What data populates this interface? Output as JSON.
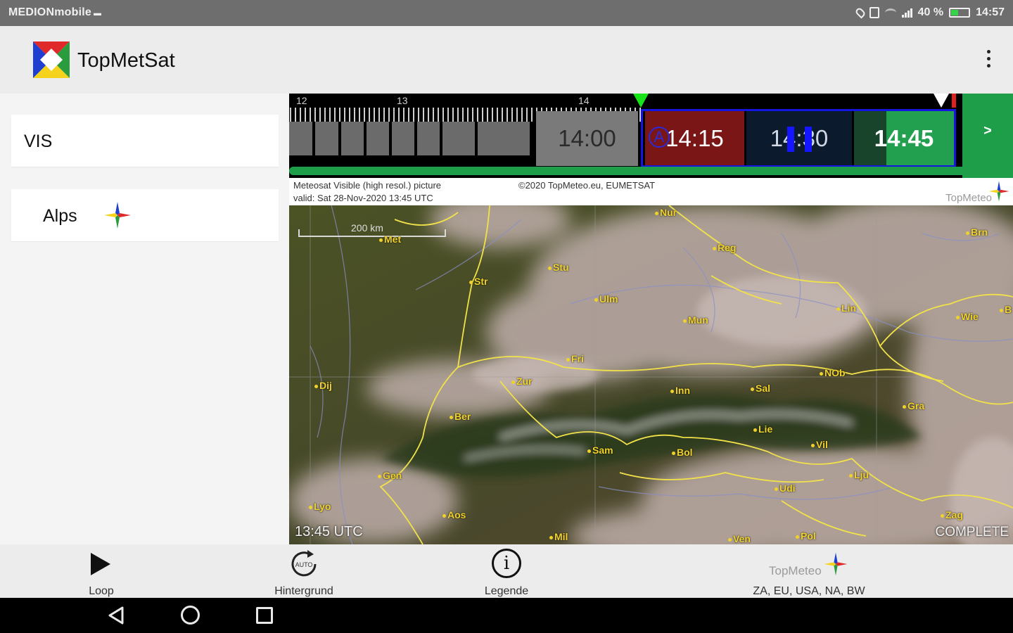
{
  "status_bar": {
    "carrier": "MEDIONmobile",
    "battery": "40 %",
    "battery_level": 0.4,
    "time": "14:57"
  },
  "app_bar": {
    "title": "TopMetSat"
  },
  "sidebar": {
    "product": "VIS",
    "region": "Alps"
  },
  "timeline": {
    "hour_labels": [
      "12",
      "13",
      "14"
    ],
    "slots": {
      "t1400": "14:00",
      "t1415": "14:15",
      "t1430": "14:30",
      "t1445": "14:45"
    },
    "auto_marker": "A",
    "next_label": ">"
  },
  "image_header": {
    "line1": "Meteosat Visible (high resol.) picture",
    "line2": "valid:  Sat  28-Nov-2020  13:45 UTC",
    "copyright": "©2020 TopMeteo.eu, EUMETSAT",
    "brand": "TopMeteo"
  },
  "map": {
    "scale_label": "200 km",
    "utc_label": "13:45 UTC",
    "status_label": "COMPLETE",
    "cities": [
      "Nur",
      "Brn",
      "Met",
      "Reg",
      "Stu",
      "Str",
      "Ulm",
      "Lin",
      "Mun",
      "Wie",
      "B",
      "Fri",
      "Dij",
      "Zur",
      "Inn",
      "Sal",
      "NOb",
      "Gra",
      "Ber",
      "Lie",
      "Vil",
      "Bol",
      "Sam",
      "Lju",
      "Gen",
      "Lyo",
      "Aos",
      "Udi",
      "Zag",
      "Mil",
      "Ven",
      "Pol"
    ]
  },
  "bottom_bar": {
    "loop": "Loop",
    "background": "Hintergrund",
    "auto_icon_text": "AUTO",
    "legend": "Legende",
    "brand": "TopMeteo",
    "regions": "ZA, EU, USA, NA, BW"
  },
  "colors": {
    "status_bar": "#6e6e6e",
    "app_bar": "#ececec",
    "accent_green": "#1f9e49",
    "slot_red": "#7b1616",
    "slot_navy": "#0b1a2d",
    "selection_blue": "#1515e0",
    "city_yellow": "#f0d22a"
  }
}
